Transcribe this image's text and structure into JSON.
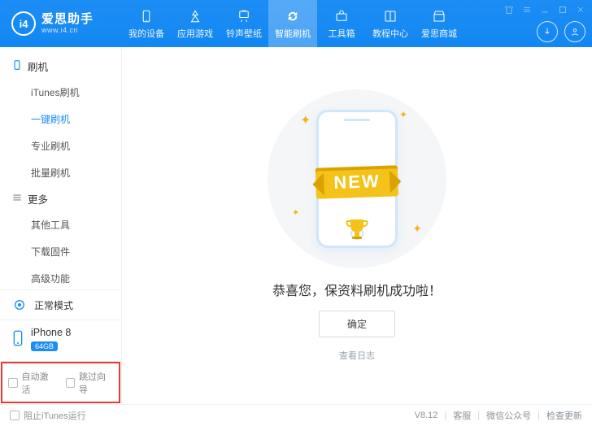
{
  "brand": {
    "logo_text": "i4",
    "name": "爱思助手",
    "url": "www.i4.cn"
  },
  "topnav": [
    {
      "id": "device",
      "label": "我的设备",
      "icon": "phone"
    },
    {
      "id": "apps",
      "label": "应用游戏",
      "icon": "apps"
    },
    {
      "id": "ring",
      "label": "铃声壁纸",
      "icon": "music"
    },
    {
      "id": "flash",
      "label": "智能刷机",
      "icon": "refresh",
      "active": true
    },
    {
      "id": "tools",
      "label": "工具箱",
      "icon": "toolbox"
    },
    {
      "id": "tutorial",
      "label": "教程中心",
      "icon": "book"
    },
    {
      "id": "store",
      "label": "爱思商城",
      "icon": "store"
    }
  ],
  "sidebar": {
    "groups": [
      {
        "title": "刷机",
        "items": [
          {
            "id": "itunes",
            "label": "iTunes刷机"
          },
          {
            "id": "oneclick",
            "label": "一键刷机",
            "active": true
          },
          {
            "id": "pro",
            "label": "专业刷机"
          },
          {
            "id": "batch",
            "label": "批量刷机"
          }
        ]
      },
      {
        "title": "更多",
        "items": [
          {
            "id": "other",
            "label": "其他工具"
          },
          {
            "id": "fw",
            "label": "下载固件"
          },
          {
            "id": "adv",
            "label": "高级功能"
          }
        ]
      }
    ],
    "mode_label": "正常模式",
    "device": {
      "name": "iPhone 8",
      "storage": "64GB"
    },
    "checks": {
      "auto_activate": "自动激活",
      "skip_guide": "跳过向导"
    }
  },
  "main": {
    "ribbon_text": "NEW",
    "headline": "恭喜您，保资料刷机成功啦！",
    "ok_label": "确定",
    "view_log": "查看日志"
  },
  "footer": {
    "prevent_itunes": "阻止iTunes运行",
    "version": "V8.12",
    "support": "客服",
    "wechat": "微信公众号",
    "update": "检查更新"
  }
}
